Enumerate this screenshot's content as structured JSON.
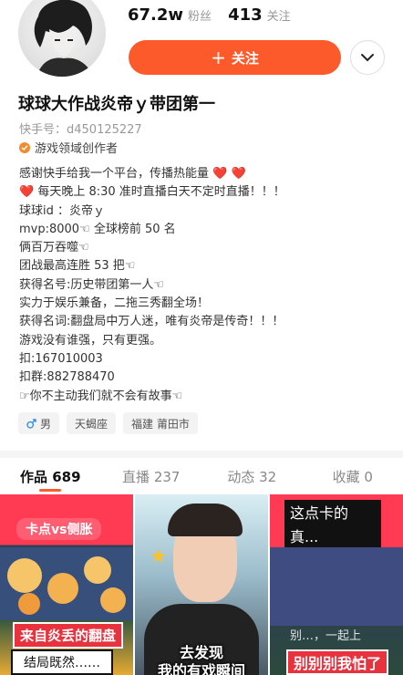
{
  "profile": {
    "followers_count": "67.2w",
    "followers_label": "粉丝",
    "following_count": "413",
    "following_label": "关注",
    "follow_button_label": "关注",
    "name": "球球大作战炎帝ｙ带团第一",
    "kuaishou_id": "快手号：d450125227",
    "creator_tag": "游戏领域创作者"
  },
  "bio_lines": [
    "感谢快手给我一个平台，传播热能量 ❤️ ❤️",
    "❤️ 每天晚上 8:30 准时直播白天不定时直播！！！",
    "球球id ：炎帝ｙ",
    "mvp:8000☜   全球榜前 50 名",
    "俩百万吞噬☜",
    "团战最高连胜 53 把☜",
    "获得名号:历史带团第一人☜",
    "实力于娱乐兼备，二拖三秀翻全场！",
    "获得名词:翻盘局中万人迷，唯有炎帝是传奇！！！",
    "游戏没有谁强，只有更强。",
    "扣:167010003",
    "扣群:882788470",
    "☞你不主动我们就不会有故事☜"
  ],
  "tags": [
    {
      "icon": "male-icon",
      "label": "男"
    },
    {
      "icon": "",
      "label": "天蝎座"
    },
    {
      "icon": "",
      "label": "福建 莆田市"
    }
  ],
  "tabs": [
    {
      "label": "作品 689",
      "active": true
    },
    {
      "label": "直播 237",
      "active": false
    },
    {
      "label": "动态 32",
      "active": false
    },
    {
      "label": "收藏 0",
      "active": false
    }
  ],
  "thumbnails": [
    {
      "top_text": "卡点vs侧胀",
      "mid_text": "来自炎丢的翻盘",
      "bottom_text": "结局既然……"
    },
    {
      "caption": "去发现\n我的有戏瞬间"
    },
    {
      "top_text": "这点卡的\n真...",
      "mid_text": "别…，一起上",
      "bottom_text": "别别别我怕了"
    }
  ],
  "colors": {
    "accent": "#fd5a2b",
    "creator_badge": "#f28a2e"
  }
}
